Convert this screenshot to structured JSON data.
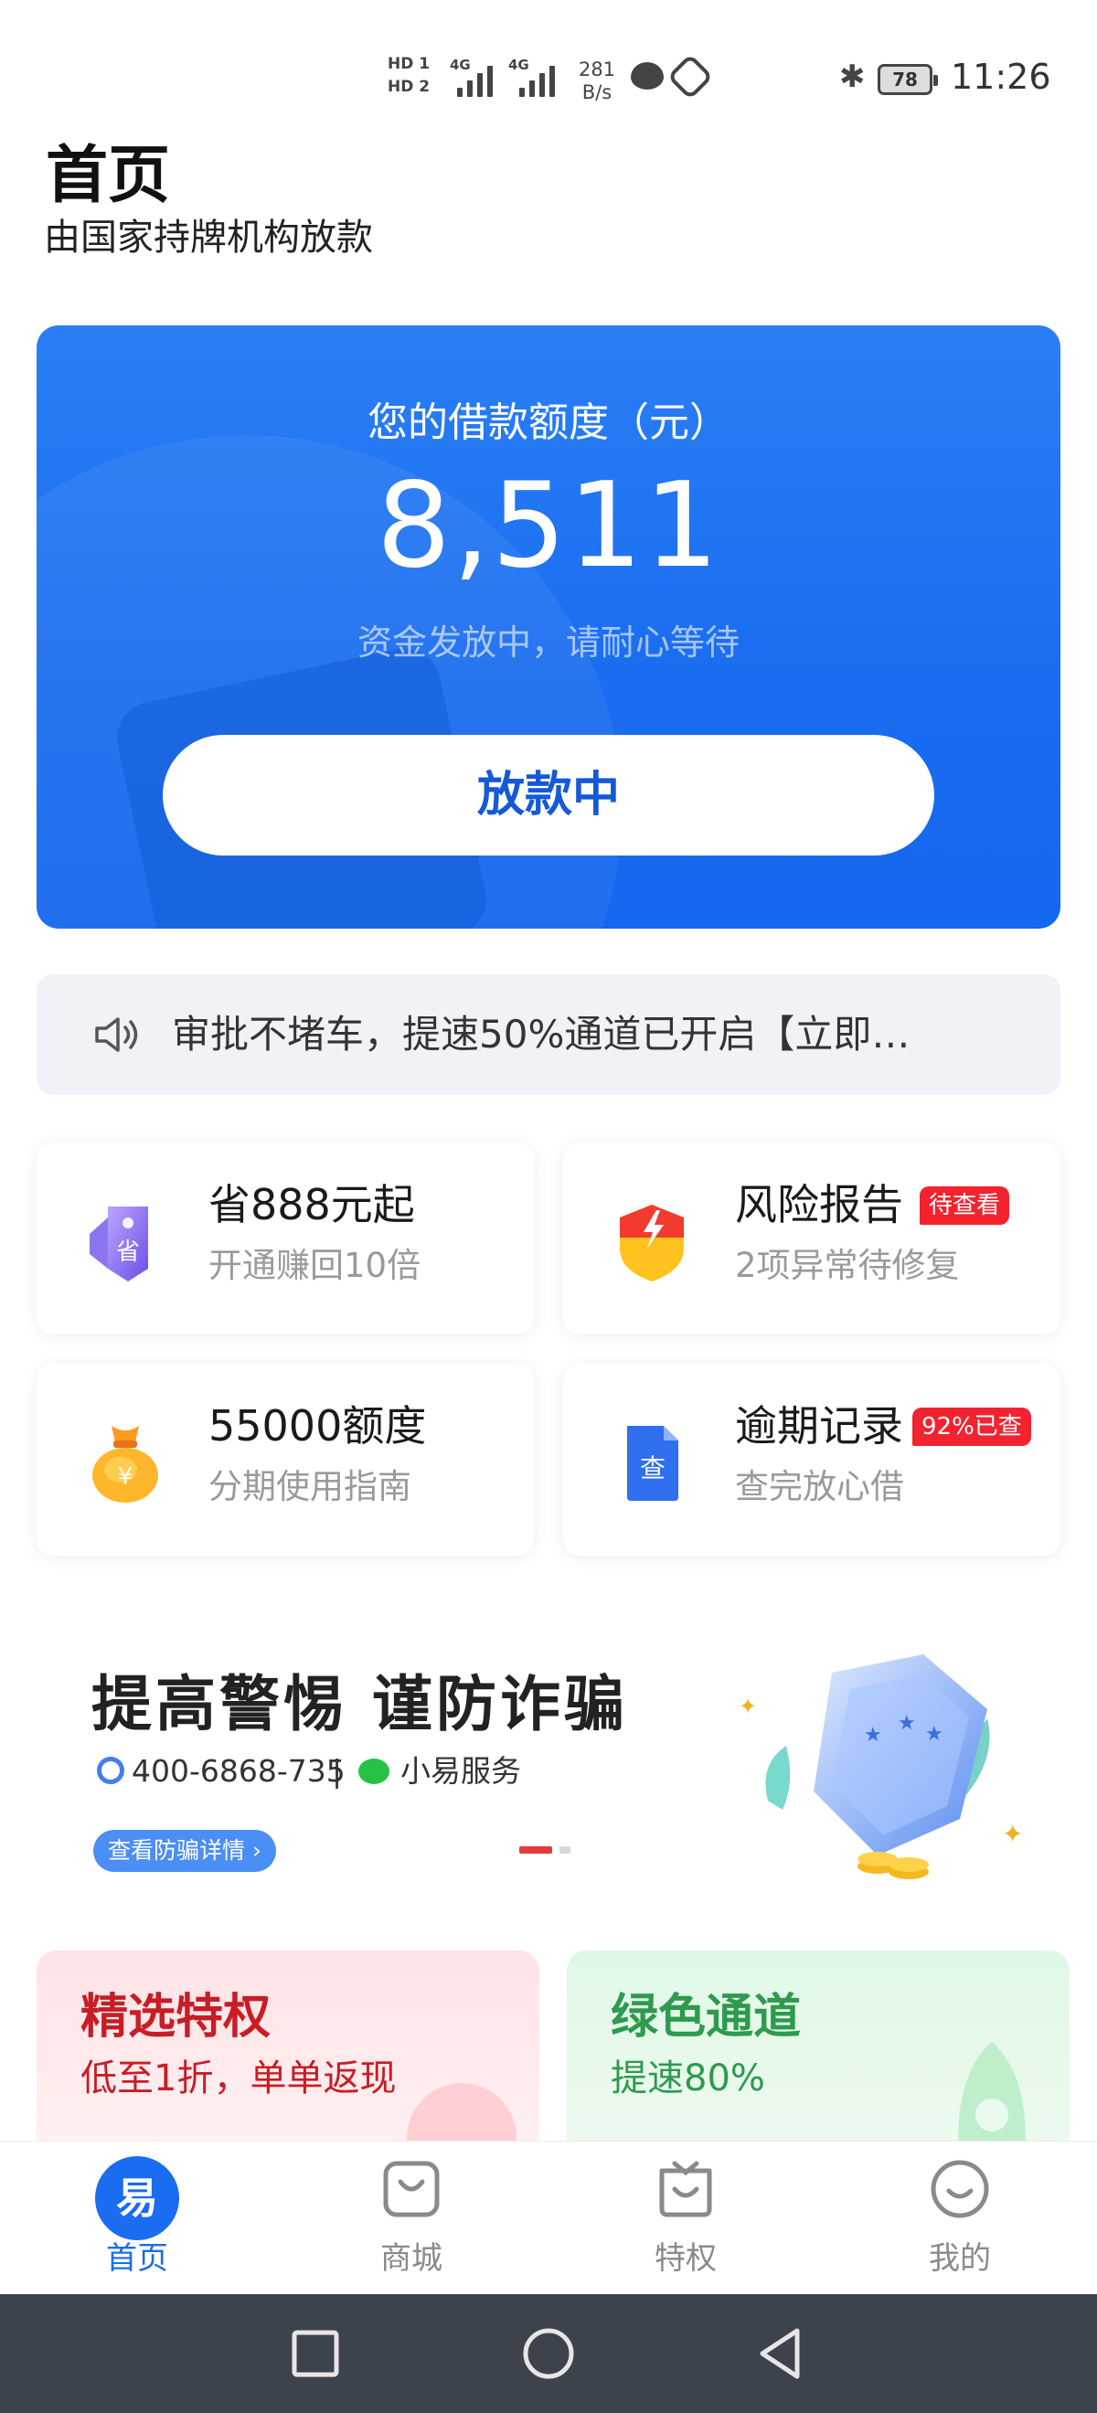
{
  "status_bar": {
    "hd1": "HD 1",
    "hd2": "HD 2",
    "network1": "4G",
    "network2": "4G",
    "speed_value": "281",
    "speed_unit": "B/s",
    "battery": "78",
    "time": "11:26",
    "icons": [
      "message-icon",
      "hand-icon",
      "bluetooth-icon",
      "battery-icon"
    ]
  },
  "header": {
    "title": "首页",
    "subtitle": "由国家持牌机构放款"
  },
  "credit": {
    "label": "您的借款额度（元）",
    "amount": "8,511",
    "status": "资金发放中，请耐心等待",
    "button": "放款中"
  },
  "notice": {
    "text": "审批不堵车，提速50%通道已开启【立即…"
  },
  "tiles": [
    {
      "title": "省888元起",
      "sub": "开通赚回10倍",
      "badge": "",
      "icon": "save-tag-icon",
      "icon_text": "省"
    },
    {
      "title": "风险报告",
      "sub": "2项异常待修复",
      "badge": "待查看",
      "icon": "risk-shield-icon"
    },
    {
      "title": "55000额度",
      "sub": "分期使用指南",
      "badge": "",
      "icon": "money-bag-icon",
      "icon_text": "¥"
    },
    {
      "title": "逾期记录",
      "sub": "查完放心借",
      "badge": "92%已查",
      "icon": "document-icon",
      "icon_text": "查"
    }
  ],
  "banner": {
    "title": "提高警惕 谨防诈骗",
    "phone": "400-6868-735",
    "separator": "|",
    "service": "小易服务",
    "link": "查看防骗详情 ›",
    "active_slide": 1,
    "slide_count": 2
  },
  "promos": [
    {
      "title": "精选特权",
      "sub": "低至1折，单单返现"
    },
    {
      "title": "绿色通道",
      "sub": "提速80%"
    }
  ],
  "tab_bar": {
    "tabs": [
      {
        "label": "首页",
        "icon": "home-logo-icon",
        "icon_text": "易",
        "active": true
      },
      {
        "label": "商城",
        "icon": "shopping-bag-icon",
        "active": false
      },
      {
        "label": "特权",
        "icon": "privilege-bag-icon",
        "active": false
      },
      {
        "label": "我的",
        "icon": "smiley-icon",
        "active": false
      }
    ]
  },
  "colors": {
    "primary": "#1a6cf0",
    "badge_red": "#f3222f",
    "promo_red": "#c81d25",
    "promo_green": "#2e9a4e"
  }
}
